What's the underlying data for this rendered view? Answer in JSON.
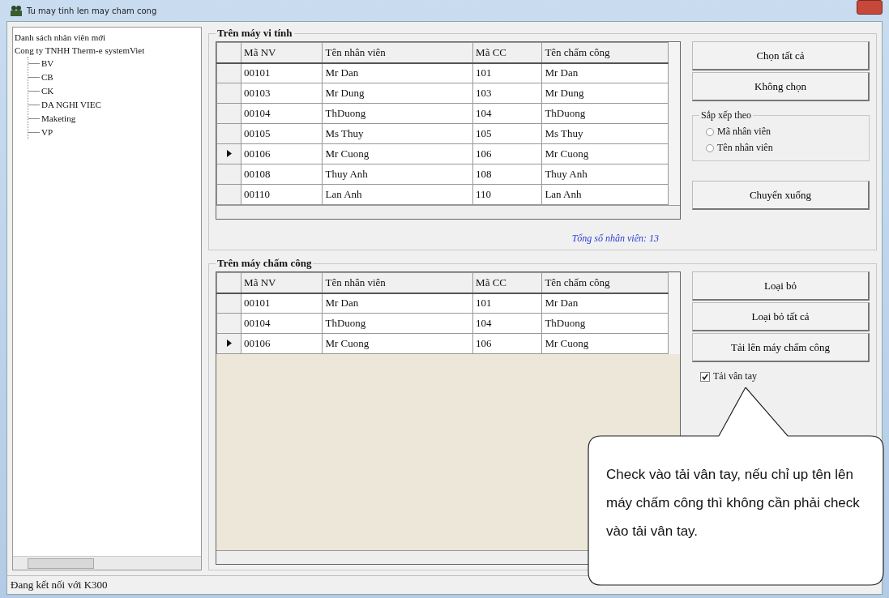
{
  "window": {
    "title": "Tu may tinh len may cham cong"
  },
  "tree": [
    {
      "label": "Danh sách nhân viên mới"
    },
    {
      "label": "Cong ty TNHH Therm-e systemViet",
      "children": [
        {
          "label": "BV"
        },
        {
          "label": "CB"
        },
        {
          "label": "CK"
        },
        {
          "label": "DA NGHI VIEC"
        },
        {
          "label": "Maketing"
        },
        {
          "label": "VP"
        }
      ]
    }
  ],
  "computer_group": {
    "title": "Trên máy vi tính",
    "columns": [
      "Mã NV",
      "Tên nhân viên",
      "Mã CC",
      "Tên chấm công"
    ],
    "rows": [
      {
        "cells": [
          "00101",
          "Mr Dan",
          "101",
          "Mr Dan"
        ],
        "selected": false
      },
      {
        "cells": [
          "00103",
          "Mr Dung",
          "103",
          "Mr Dung"
        ],
        "selected": false
      },
      {
        "cells": [
          "00104",
          "ThDuong",
          "104",
          "ThDuong"
        ],
        "selected": false
      },
      {
        "cells": [
          "00105",
          "Ms Thuy",
          "105",
          "Ms Thuy"
        ],
        "selected": false
      },
      {
        "cells": [
          "00106",
          "Mr Cuong",
          "106",
          "Mr Cuong"
        ],
        "selected": true
      },
      {
        "cells": [
          "00108",
          "Thuy Anh",
          "108",
          "Thuy Anh"
        ],
        "selected": false
      },
      {
        "cells": [
          "00110",
          "Lan Anh",
          "110",
          "Lan Anh"
        ],
        "selected": false
      }
    ],
    "total": "Tổng số nhân viên: 13"
  },
  "computer_buttons": [
    "Chọn tất cả",
    "Không chọn"
  ],
  "sort": {
    "title": "Sắp xếp theo",
    "options": [
      {
        "label": "Mã nhân viên",
        "selected": false
      },
      {
        "label": "Tên nhân viên",
        "selected": false
      }
    ]
  },
  "move_button": "Chuyển xuống",
  "device_group": {
    "title": "Trên máy chấm công",
    "columns": [
      "Mã NV",
      "Tên nhân viên",
      "Mã CC",
      "Tên chấm công"
    ],
    "rows": [
      {
        "cells": [
          "00101",
          "Mr Dan",
          "101",
          "Mr Dan"
        ],
        "selected": false
      },
      {
        "cells": [
          "00104",
          "ThDuong",
          "104",
          "ThDuong"
        ],
        "selected": false
      },
      {
        "cells": [
          "00106",
          "Mr Cuong",
          "106",
          "Mr Cuong"
        ],
        "selected": true
      }
    ]
  },
  "device_buttons": [
    "Loại bỏ",
    "Loại bỏ tất cả",
    "Tải lên máy chấm công"
  ],
  "fingerprint": {
    "label": "Tải vân tay",
    "checked": true
  },
  "callout": "Check vào tải vân tay, nếu chỉ up tên lên máy chấm công thì không cần phải check vào tải vân tay.",
  "status_bar": "Đang kết nối với K300"
}
